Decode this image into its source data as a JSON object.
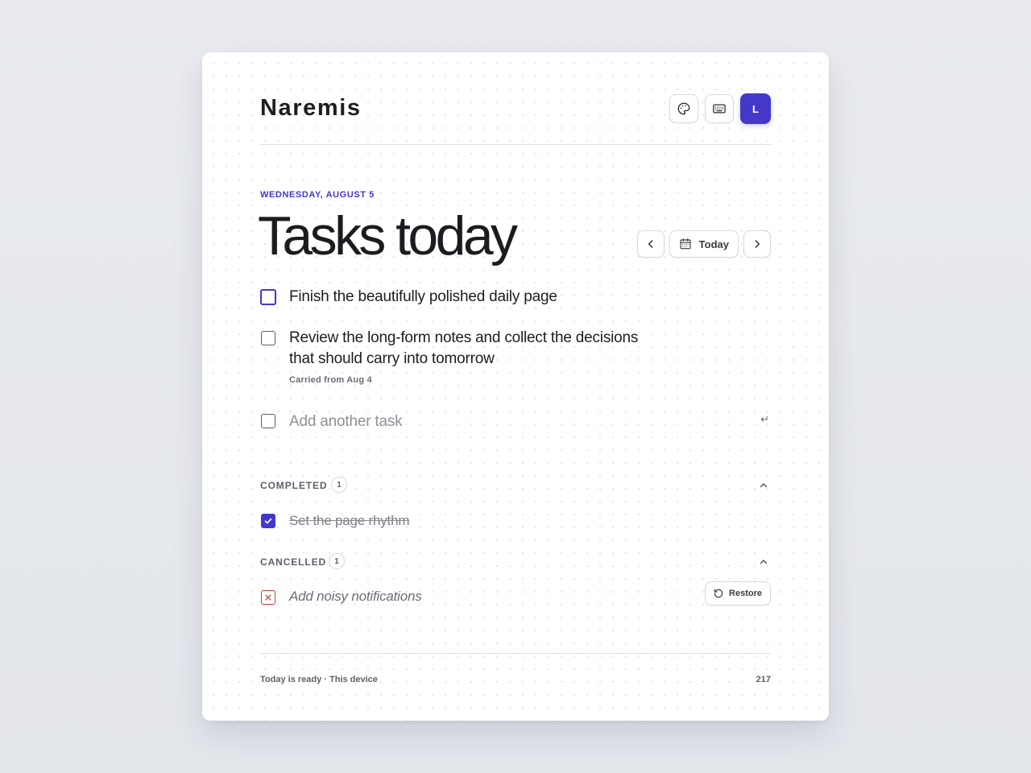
{
  "app": {
    "brand": "Naremis",
    "avatar_initial": "L",
    "theme_icon": "palette-icon",
    "shortcuts_icon": "keyboard-icon",
    "accent_color": "#4338ca",
    "cancel_color": "#c43b3b"
  },
  "header": {
    "date_label": "WEDNESDAY, AUGUST 5",
    "title": "Tasks today",
    "today_label": "Today"
  },
  "tasks": [
    {
      "text": "Finish the beautifully polished daily page",
      "sub": ""
    },
    {
      "text_line1": "Review the long-form notes and collect the decisions",
      "text_line2": "that should carry into tomorrow",
      "sub": "Carried from Aug 4"
    }
  ],
  "add_task": {
    "placeholder": "Add another task",
    "enter_hint": "↵"
  },
  "completed": {
    "label": "COMPLETED",
    "count": "1",
    "items": [
      {
        "text": "Set the page rhythm"
      }
    ]
  },
  "cancelled": {
    "label": "CANCELLED",
    "count": "1",
    "items": [
      {
        "text": "Add noisy notifications",
        "action": "Restore"
      }
    ]
  },
  "footer": {
    "status": "Today is ready · This device",
    "count": "217"
  }
}
